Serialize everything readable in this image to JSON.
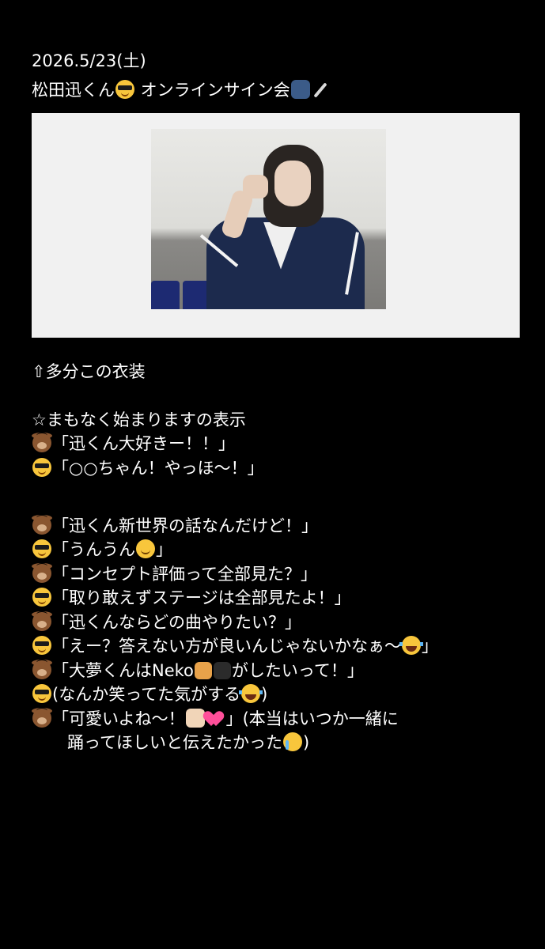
{
  "note": {
    "date": "2026.5/23(土)",
    "title_prefix": "松田迅くん",
    "title_suffix": " オンラインサイン会",
    "caption": "⇧多分この衣装",
    "status_line": "☆まもなく始まりますの表示",
    "lines": [
      {
        "speaker": "bear",
        "text": "「迅くん大好きー！！」"
      },
      {
        "speaker": "cool",
        "text": "「○○ちゃん！やっほ〜！」"
      },
      {
        "speaker": "bear",
        "text": "「迅くん新世界の話なんだけど！」"
      },
      {
        "speaker": "cool",
        "text_before": "「うんうん",
        "text_after": "」"
      },
      {
        "speaker": "bear",
        "text": "「コンセプト評価って全部見た？」"
      },
      {
        "speaker": "cool",
        "text": "「取り敢えずステージは全部見たよ！」"
      },
      {
        "speaker": "bear",
        "text": "「迅くんならどの曲やりたい？」"
      },
      {
        "speaker": "cool",
        "text_before": "「えー？答えない方が良いんじゃないかなぁ〜",
        "text_after": "」"
      },
      {
        "speaker": "bear",
        "text_before": "「大夢くんはNeko",
        "text_after": "がしたいって！」"
      },
      {
        "speaker": "cool",
        "text_before": "(なんか笑ってた気がする",
        "text_after": ")"
      },
      {
        "speaker": "bear",
        "text_before": "「可愛いよね〜！",
        "text_after": "」(本当はいつか一緒に"
      },
      {
        "speaker": "none",
        "text_before": "踊ってほしいと伝えたかった",
        "text_after": ")"
      }
    ]
  },
  "colors": {
    "background": "#000000",
    "text": "#ffffff",
    "photo_frame": "#f1f1f1"
  },
  "icons": [
    "sunglasses-face-icon",
    "speaking-head-icon",
    "fountain-pen-icon",
    "bear-face-icon",
    "slightly-smiling-face-icon",
    "tears-of-joy-icon",
    "cat-icon",
    "black-cat-icon",
    "hamster-icon",
    "two-hearts-icon",
    "crying-face-icon"
  ]
}
